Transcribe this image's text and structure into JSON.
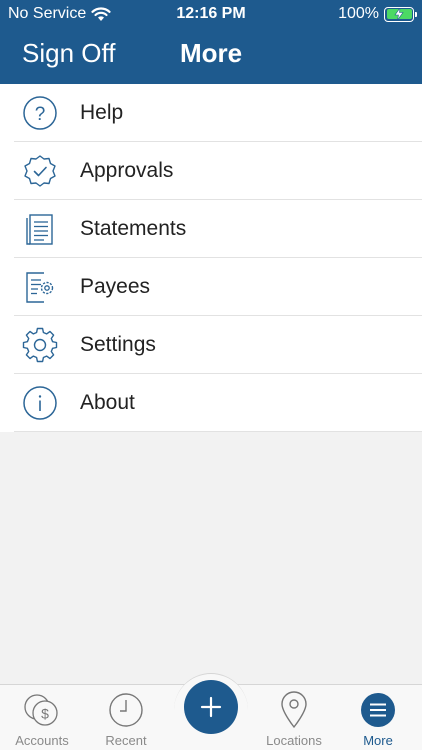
{
  "status_bar": {
    "carrier": "No Service",
    "time": "12:16 PM",
    "battery": "100%"
  },
  "header": {
    "left_button": "Sign Off",
    "title": "More"
  },
  "menu": {
    "items": [
      {
        "label": "Help",
        "icon": "help-icon"
      },
      {
        "label": "Approvals",
        "icon": "approval-badge-icon"
      },
      {
        "label": "Statements",
        "icon": "document-icon"
      },
      {
        "label": "Payees",
        "icon": "payee-settings-icon"
      },
      {
        "label": "Settings",
        "icon": "gear-icon"
      },
      {
        "label": "About",
        "icon": "info-icon"
      }
    ]
  },
  "tabbar": {
    "tabs": [
      {
        "label": "Accounts",
        "icon": "coins-icon"
      },
      {
        "label": "Recent",
        "icon": "clock-icon"
      },
      {
        "label": "Locations",
        "icon": "map-pin-icon"
      },
      {
        "label": "More",
        "icon": "menu-icon"
      }
    ],
    "fab_icon": "plus-icon"
  },
  "colors": {
    "brand": "#1e5a8e",
    "icon_stroke": "#2c6697",
    "battery": "#4cd964"
  }
}
